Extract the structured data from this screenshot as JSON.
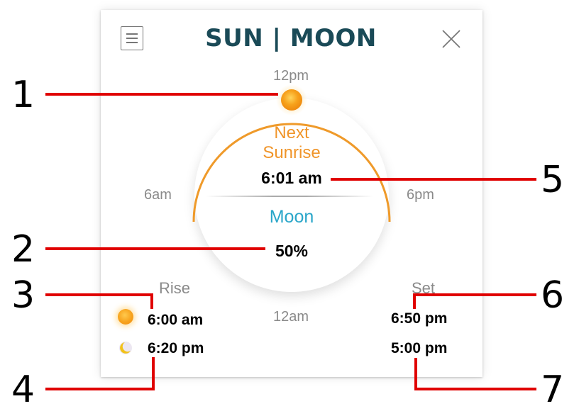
{
  "header": {
    "title": "SUN | MOON",
    "menu_icon": "hamburger-menu-icon",
    "close_icon": "close-icon"
  },
  "dial": {
    "label_top": "12pm",
    "label_left": "6am",
    "label_right": "6pm",
    "label_bottom": "12am",
    "next_sunrise_line1": "Next",
    "next_sunrise_line2": "Sunrise",
    "next_sunrise_time": "6:01 am",
    "moon_label": "Moon",
    "moon_phase": "50%"
  },
  "rise": {
    "label": "Rise",
    "sun_time": "6:00 am",
    "moon_time": "6:20 pm"
  },
  "set": {
    "label": "Set",
    "sun_time": "6:50 pm",
    "moon_time": "5:00 pm"
  },
  "callouts": [
    "1",
    "2",
    "3",
    "4",
    "5",
    "6",
    "7"
  ],
  "colors": {
    "title": "#1a4a57",
    "sun_accent": "#f0952a",
    "moon_accent": "#2aa6c9",
    "callout_line": "#e00000"
  }
}
